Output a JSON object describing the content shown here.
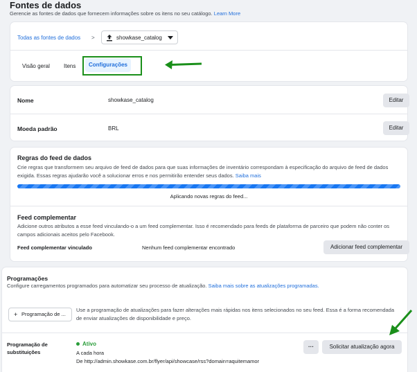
{
  "header": {
    "title": "Fontes de dados",
    "subtitle": "Gerencie as fontes de dados que fornecem informações sobre os itens no seu catálogo.",
    "learn_more": "Learn More"
  },
  "breadcrumb": {
    "root": "Todas as fontes de dados",
    "separator": ">",
    "current": "showkase_catalog"
  },
  "tabs": [
    {
      "label": "Visão geral"
    },
    {
      "label": "Itens"
    },
    {
      "label": "Configurações"
    }
  ],
  "settings": {
    "name_label": "Nome",
    "name_value": "showkase_catalog",
    "currency_label": "Moeda padrão",
    "currency_value": "BRL",
    "edit_label": "Editar"
  },
  "feed_rules": {
    "title": "Regras do feed de dados",
    "description": "Crie regras que transformem seu arquivo de feed de dados para que suas informações de inventário correspondam à especificação do arquivo de feed de dados exigida. Essas regras ajudarão você a solucionar erros e nos permitirão entender seus dados.",
    "learn_more": "Saiba mais",
    "progress_text": "Aplicando novas regras do feed...",
    "progress": 1.0
  },
  "supplementary": {
    "title": "Feed complementar",
    "description": "Adicione outros atributos a esse feed vinculando-o a um feed complementar. Isso é recomendado para feeds de plataforma de parceiro que podem não conter os campos adicionais aceitos pelo Facebook.",
    "linked_label": "Feed complementar vinculado",
    "linked_value": "Nenhum feed complementar encontrado",
    "add_button": "Adicionar feed complementar"
  },
  "schedules": {
    "title": "Programações",
    "description": "Configure carregamentos programados para automatizar seu processo de atualização.",
    "learn_more": "Saiba mais sobre as atualizações programadas.",
    "add_schedule_button": "Programação de ...",
    "add_schedule_plus": "+",
    "update_info": "Use a programação de atualizações para fazer alterações mais rápidas nos itens selecionados no seu feed. Essa é a forma recomendada de enviar atualizações de disponibilidade e preço.",
    "replace_label_1": "Programação de",
    "replace_label_2": "substituições",
    "status": "Ativo",
    "frequency": "A cada hora",
    "from_prefix": "De",
    "url": "http://admin.showkase.com.br/flyer/api/showcase/rss?domain=aquitemamor",
    "more_button": "···",
    "request_button": "Solicitar atualização agora"
  },
  "colors": {
    "accent": "#216fdb",
    "annotation_green": "#1a8f1a",
    "status_green": "#2a9d3a"
  }
}
